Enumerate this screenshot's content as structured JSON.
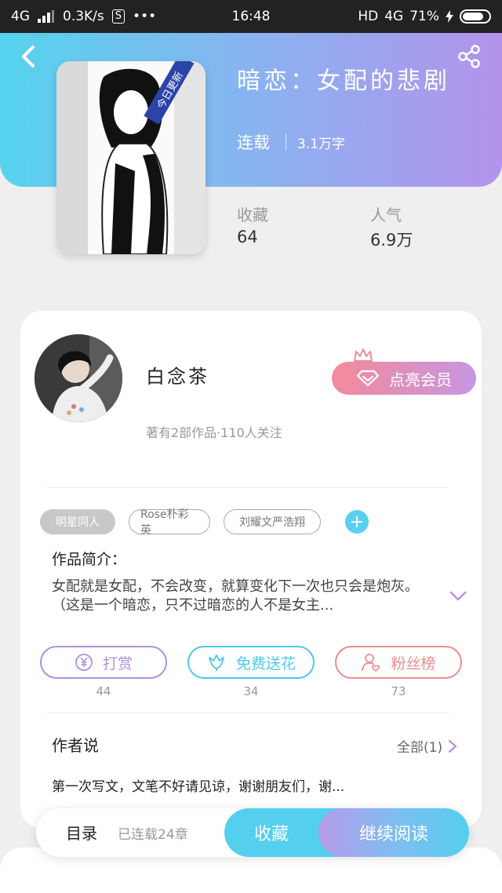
{
  "status_bar": {
    "network": "4G",
    "speed": "0.3K/s",
    "s_badge": "S",
    "more": "•••",
    "time": "16:48",
    "hd": "HD",
    "network_right": "4G",
    "battery": "71%",
    "battery_level": 0.71
  },
  "book": {
    "title": "暗恋：女配的悲剧",
    "status": "连载",
    "words": "3.1万字",
    "cover_badge": "今日更新"
  },
  "stats": {
    "favorites_label": "收藏",
    "favorites_value": "64",
    "popularity_label": "人气",
    "popularity_value": "6.9万"
  },
  "author": {
    "name": "白念茶",
    "meta": "著有2部作品·110人关注",
    "vip_button": "点亮会员"
  },
  "tags": [
    "明星同人",
    "Rose朴彩英",
    "刘耀文严浩翔"
  ],
  "intro": {
    "title": "作品简介：",
    "text": "女配就是女配，不会改变，就算变化下一次也只会是炮灰。（这是一个暗恋，只不过暗恋的人不是女主..."
  },
  "actions": [
    {
      "label": "打赏",
      "count": "44",
      "color": "#b28ee0",
      "icon": "yen-icon"
    },
    {
      "label": "免费送花",
      "count": "34",
      "color": "#4fc9ea",
      "icon": "flower-icon"
    },
    {
      "label": "粉丝榜",
      "count": "73",
      "color": "#ee8d8d",
      "icon": "fans-icon"
    }
  ],
  "author_says": {
    "title": "作者说",
    "all": "全部(1)",
    "text": "第一次写文，文笔不好请见谅，谢谢朋友们，谢..."
  },
  "bottom": {
    "toc": "目录",
    "toc_count": "已连载24章",
    "favorite": "收藏",
    "continue": "继续阅读"
  },
  "colors": {
    "header_start": "#56d3ee",
    "header_end": "#b393ec",
    "accent_blue": "#55cfee",
    "vip_pink": "#f38a9a"
  }
}
